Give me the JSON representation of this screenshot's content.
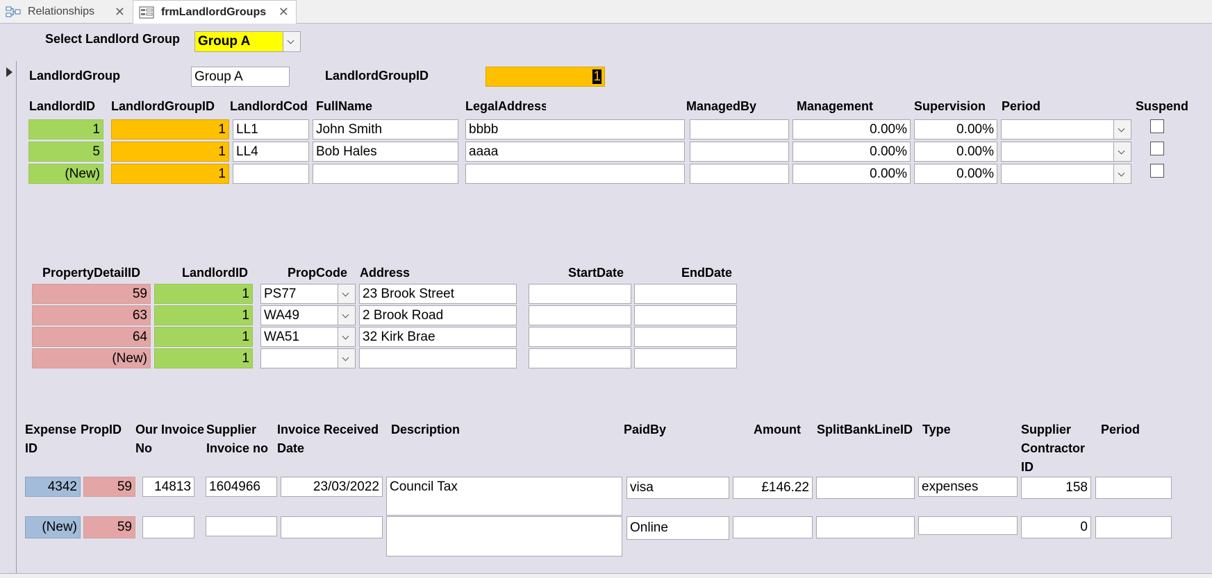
{
  "tabs": [
    {
      "label": "Relationships",
      "icon": "relationships-icon"
    },
    {
      "label": "frmLandlordGroups",
      "icon": "form-icon"
    }
  ],
  "close_glyph": "✕",
  "select_group": {
    "label": "Select Landlord Group",
    "value": "Group A"
  },
  "header": {
    "landlord_group_label": "LandlordGroup",
    "landlord_group_value": "Group A",
    "landlord_group_id_label": "LandlordGroupID",
    "landlord_group_id_value": "1"
  },
  "landlords": {
    "headers": [
      "LandlordID",
      "LandlordGroupID",
      "LandlordCode",
      "FullName",
      "LegalAddress",
      "ManagedBy",
      "Management",
      "Supervision",
      "Period",
      "Suspend"
    ],
    "rows": [
      {
        "id": "1",
        "group_id": "1",
        "code": "LL1",
        "full_name": "John Smith",
        "legal_address": "bbbb",
        "managed_by": "",
        "management": "0.00%",
        "supervision": "0.00%",
        "period": ""
      },
      {
        "id": "5",
        "group_id": "1",
        "code": "LL4",
        "full_name": "Bob Hales",
        "legal_address": "aaaa",
        "managed_by": "",
        "management": "0.00%",
        "supervision": "0.00%",
        "period": ""
      },
      {
        "id": "(New)",
        "group_id": "1",
        "code": "",
        "full_name": "",
        "legal_address": "",
        "managed_by": "",
        "management": "0.00%",
        "supervision": "0.00%",
        "period": ""
      }
    ]
  },
  "properties": {
    "headers": [
      "PropertyDetailID",
      "LandlordID",
      "PropCode",
      "Address",
      "StartDate",
      "EndDate"
    ],
    "rows": [
      {
        "id": "59",
        "landlord_id": "1",
        "prop_code": "PS77",
        "address": "23 Brook Street",
        "start": "",
        "end": ""
      },
      {
        "id": "63",
        "landlord_id": "1",
        "prop_code": "WA49",
        "address": "2 Brook Road",
        "start": "",
        "end": ""
      },
      {
        "id": "64",
        "landlord_id": "1",
        "prop_code": "WA51",
        "address": "32 Kirk Brae",
        "start": "",
        "end": ""
      },
      {
        "id": "(New)",
        "landlord_id": "1",
        "prop_code": "",
        "address": "",
        "start": "",
        "end": ""
      }
    ]
  },
  "expenses": {
    "headers": [
      "Expense ID",
      "PropID",
      "Our Invoice No",
      "Supplier Invoice no",
      "Invoice Received Date",
      "Description",
      "PaidBy",
      "Amount",
      "SplitBankLineID",
      "Type",
      "Supplier Contractor ID",
      "Period"
    ],
    "rows": [
      {
        "id": "4342",
        "prop_id": "59",
        "our_invoice": "14813",
        "supplier_invoice": "1604966",
        "received": "23/03/2022",
        "description": "Council Tax",
        "paid_by": "visa",
        "amount": "£146.22",
        "split": "",
        "type": "expenses",
        "supplier_id": "158",
        "period": ""
      },
      {
        "id": "(New)",
        "prop_id": "59",
        "our_invoice": "",
        "supplier_invoice": "",
        "received": "",
        "description": "",
        "paid_by": "Online",
        "amount": "",
        "split": "",
        "type": "",
        "supplier_id": "0",
        "period": ""
      }
    ]
  }
}
